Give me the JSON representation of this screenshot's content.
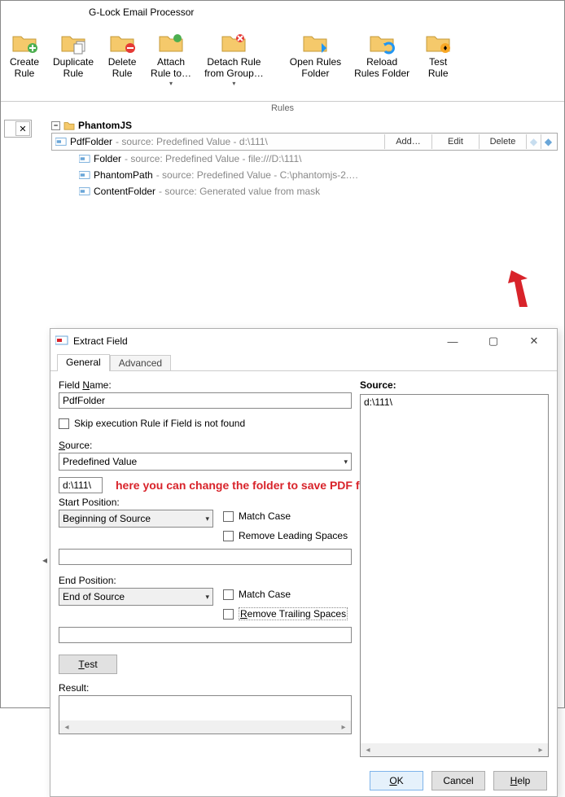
{
  "app_title": "G-Lock Email Processor",
  "ribbon": {
    "group_label": "Rules",
    "create": "Create\nRule",
    "duplicate": "Duplicate\nRule",
    "delete": "Delete\nRule",
    "attach": "Attach\nRule to…",
    "detach": "Detach Rule\nfrom Group…",
    "open_folder": "Open Rules\nFolder",
    "reload": "Reload\nRules Folder",
    "test": "Test\nRule"
  },
  "tree": {
    "root": "PhantomJS",
    "rows": [
      {
        "name": "PdfFolder",
        "src": " - source: Predefined Value - d:\\111\\"
      },
      {
        "name": "Folder",
        "src": " - source: Predefined Value - file:///D:\\111\\"
      },
      {
        "name": "PhantomPath",
        "src": " - source: Predefined Value - C:\\phantomjs-2.…"
      },
      {
        "name": "ContentFolder",
        "src": " - source: Generated value from mask"
      }
    ],
    "row_buttons": {
      "add": "Add…",
      "edit": "Edit",
      "delete": "Delete"
    }
  },
  "dialog": {
    "title": "Extract Field",
    "tabs": {
      "general": "General",
      "advanced": "Advanced"
    },
    "field_name_label_pre": "Field ",
    "field_name_label_u": "N",
    "field_name_label_post": "ame:",
    "field_name_value": "PdfFolder",
    "skip_label": "Skip execution Rule if Field is not found",
    "source_label_u": "S",
    "source_label_post": "ource:",
    "source_value": "Predefined Value",
    "path_value": "d:\\111\\",
    "annotation": "here you can change the folder to save PDF files",
    "start_pos_label": "Start Position:",
    "start_pos_value": "Beginning of Source",
    "end_pos_label": "End Position:",
    "end_pos_value": "End of Source",
    "match_case": "Match Case",
    "remove_leading": "Remove Leading Spaces",
    "remove_trailing_u": "R",
    "remove_trailing_post": "emove Trailing Spaces",
    "test_btn_u": "T",
    "test_btn_post": "est",
    "result_label": "Result:",
    "right_label": "Source:",
    "right_value": "d:\\111\\",
    "ok_u": "O",
    "ok_post": "K",
    "cancel": "Cancel",
    "help_u": "H",
    "help_post": "elp"
  }
}
